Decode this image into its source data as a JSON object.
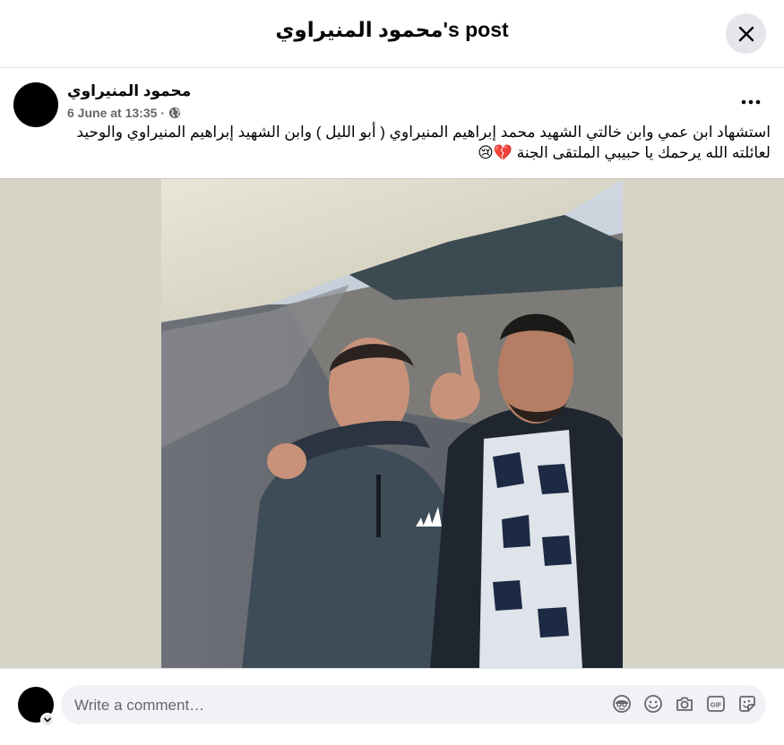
{
  "header": {
    "title": "محمود المنيراوي's post"
  },
  "post": {
    "author": "محمود المنيراوي",
    "timestamp": "6 June at 13:35",
    "separator": "·",
    "privacy_icon": "globe-icon",
    "text_line1": "استشهاد ابن عمي وابن خالتي الشهيد محمد إبراهيم المنيراوي ( أبو الليل ) وابن الشهيد إبراهيم المنيراوي والوحيد",
    "text_line2": "لعائلته الله يرحمك يا حبيبي الملتقى الجنة 💔😢"
  },
  "comment": {
    "placeholder": "Write a comment…",
    "icons": [
      "avatar-sticker-icon",
      "emoji-icon",
      "camera-icon",
      "gif-icon",
      "sticker-icon"
    ]
  },
  "colors": {
    "header_border": "#dadde1",
    "secondary_text": "#65676b",
    "button_bg": "#e4e6eb",
    "input_bg": "#f0f2f5",
    "photo_backdrop": "#d6d4c7"
  }
}
